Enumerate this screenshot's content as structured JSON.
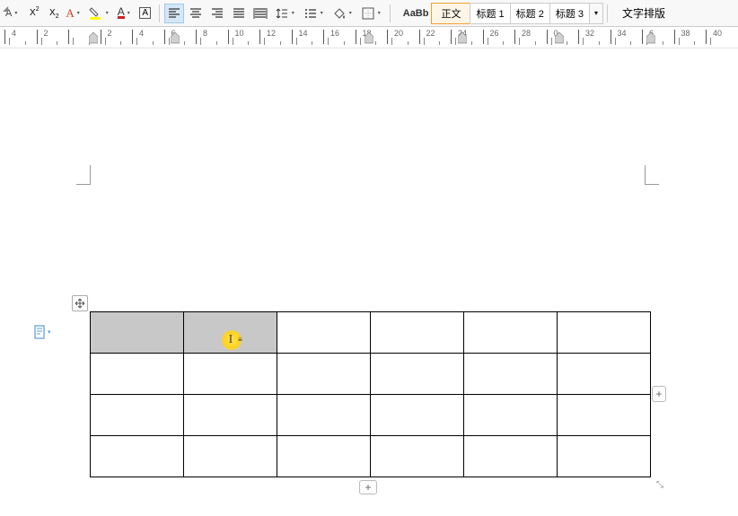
{
  "toolbar": {
    "clear_format": "A",
    "superscript": "X",
    "subscript": "X",
    "font_style": "A",
    "highlight": "",
    "font_color": "A",
    "char_border": "A"
  },
  "styles": {
    "preview": "AaBb",
    "items": [
      "正文",
      "标题 1",
      "标题 2",
      "标题 3"
    ]
  },
  "right_label": "文字排版",
  "ruler": {
    "labels": [
      "4",
      "2",
      "",
      "2",
      "4",
      "6",
      "8",
      "10",
      "12",
      "14",
      "16",
      "18",
      "20",
      "22",
      "24",
      "26",
      "28",
      "0",
      "32",
      "34",
      "6",
      "38",
      "40"
    ]
  },
  "table": {
    "rows": 4,
    "cols": 6,
    "selected_cells": [
      [
        0,
        0
      ],
      [
        0,
        1
      ]
    ]
  },
  "add_symbol": "+",
  "move_symbol": "✥",
  "resize_symbol": "⤡",
  "more_symbol": "▾",
  "caret": "▾"
}
